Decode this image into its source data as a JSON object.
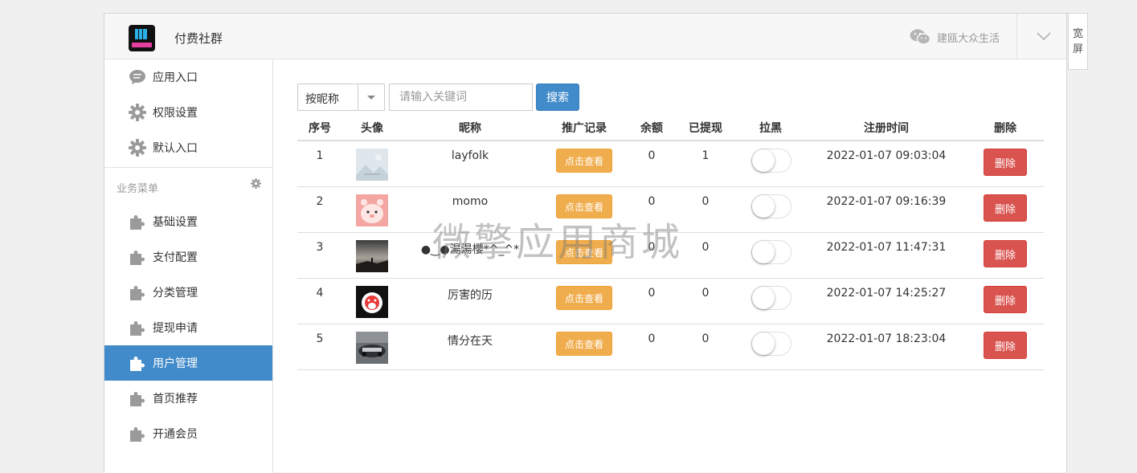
{
  "app": {
    "title": "付费社群"
  },
  "header": {
    "account_name": "建瓯大众生活",
    "wide_label": "宽屏"
  },
  "sidebar": {
    "top_items": [
      {
        "label": "应用入口",
        "icon": "chat-bubble-icon"
      },
      {
        "label": "权限设置",
        "icon": "gear-icon"
      },
      {
        "label": "默认入口",
        "icon": "gear-icon"
      }
    ],
    "section_title": "业务菜单",
    "business_items": [
      {
        "label": "基础设置",
        "icon": "puzzle-icon"
      },
      {
        "label": "支付配置",
        "icon": "puzzle-icon"
      },
      {
        "label": "分类管理",
        "icon": "puzzle-icon"
      },
      {
        "label": "提现申请",
        "icon": "puzzle-icon"
      },
      {
        "label": "用户管理",
        "icon": "puzzle-icon",
        "active": true
      },
      {
        "label": "首页推荐",
        "icon": "puzzle-icon"
      },
      {
        "label": "开通会员",
        "icon": "puzzle-icon"
      }
    ]
  },
  "search": {
    "field_select": "按昵称",
    "placeholder": "请输入关键词",
    "button_label": "搜索"
  },
  "table": {
    "columns": [
      "序号",
      "头像",
      "昵称",
      "推广记录",
      "余额",
      "已提现",
      "拉黑",
      "注册时间",
      "删除"
    ],
    "view_label": "点击查看",
    "delete_label": "删除",
    "rows": [
      {
        "index": "1",
        "nickname": "layfolk",
        "balance": "0",
        "withdrawn": "1",
        "blacklisted": false,
        "registered": "2022-01-07 09:03:04"
      },
      {
        "index": "2",
        "nickname": "momo",
        "balance": "0",
        "withdrawn": "0",
        "blacklisted": false,
        "registered": "2022-01-07 09:16:39"
      },
      {
        "index": "3",
        "nickname": "●‿●湯湯櫻*^_^*",
        "balance": "0",
        "withdrawn": "0",
        "blacklisted": false,
        "registered": "2022-01-07 11:47:31"
      },
      {
        "index": "4",
        "nickname": "厉害的历",
        "balance": "0",
        "withdrawn": "0",
        "blacklisted": false,
        "registered": "2022-01-07 14:25:27"
      },
      {
        "index": "5",
        "nickname": "情分在天",
        "balance": "0",
        "withdrawn": "0",
        "blacklisted": false,
        "registered": "2022-01-07 18:23:04"
      }
    ]
  },
  "watermark": "微擎应用商城",
  "colors": {
    "primary": "#428bca",
    "warning": "#f0ad4e",
    "danger": "#d9534f"
  }
}
